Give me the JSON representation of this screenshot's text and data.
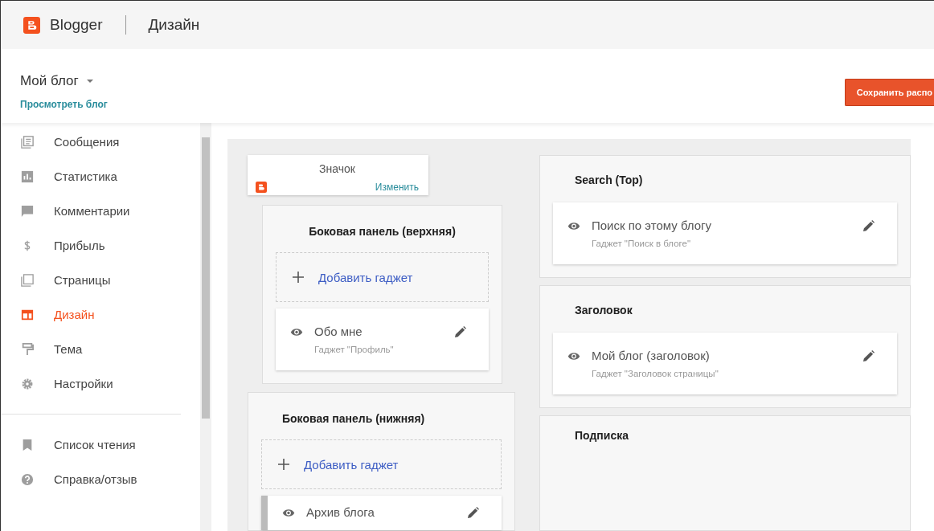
{
  "app": {
    "name": "Blogger",
    "section": "Дизайн"
  },
  "blog": {
    "name": "Мой блог",
    "view_link": "Просмотреть блог"
  },
  "save_button": "Сохранить распо",
  "sidebar": {
    "items": [
      {
        "label": "Сообщения",
        "kind": "posts",
        "selected": false
      },
      {
        "label": "Статистика",
        "kind": "stats",
        "selected": false
      },
      {
        "label": "Комментарии",
        "kind": "comments",
        "selected": false
      },
      {
        "label": "Прибыль",
        "kind": "earnings",
        "selected": false
      },
      {
        "label": "Страницы",
        "kind": "pages",
        "selected": false
      },
      {
        "label": "Дизайн",
        "kind": "layout",
        "selected": true
      },
      {
        "label": "Тема",
        "kind": "theme",
        "selected": false
      },
      {
        "label": "Настройки",
        "kind": "settings",
        "selected": false
      }
    ],
    "footer_items": [
      {
        "label": "Список чтения",
        "kind": "bookmark",
        "selected": false
      },
      {
        "label": "Справка/отзыв",
        "kind": "help",
        "selected": false
      }
    ]
  },
  "layout": {
    "favicon": {
      "title": "Значок",
      "edit": "Изменить"
    },
    "left": [
      {
        "title": "Боковая панель (верхняя)",
        "add_gadget": "Добавить гаджет",
        "gadgets": [
          {
            "name": "Обо мне",
            "type": "Гаджет \"Профиль\"",
            "visible": true
          }
        ]
      },
      {
        "title": "Боковая панель (нижняя)",
        "add_gadget": "Добавить гаджет",
        "gadgets": [
          {
            "name": "Архив блога",
            "visible": true
          }
        ]
      }
    ],
    "right": [
      {
        "title": "Search (Top)",
        "gadgets": [
          {
            "name": "Поиск по этому блогу",
            "type": "Гаджет \"Поиск в блоге\"",
            "visible": true
          }
        ]
      },
      {
        "title": "Заголовок",
        "gadgets": [
          {
            "name": "Мой блог (заголовок)",
            "type": "Гаджет \"Заголовок страницы\"",
            "visible": true
          }
        ]
      },
      {
        "title": "Подписка"
      }
    ]
  }
}
